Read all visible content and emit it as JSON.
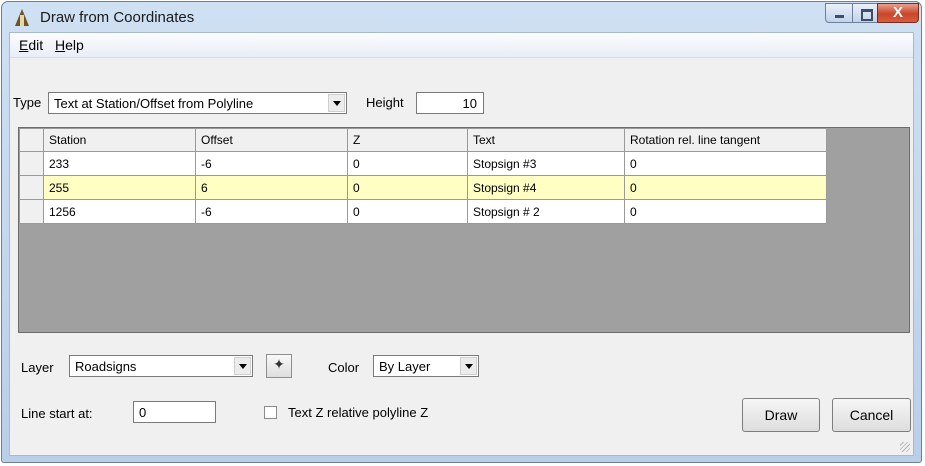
{
  "window": {
    "title": "Draw from Coordinates",
    "close_glyph": "X"
  },
  "menu": {
    "edit_label": "Edit",
    "help_label": "Help"
  },
  "type_row": {
    "type_label": "Type",
    "type_value": "Text at Station/Offset from Polyline",
    "height_label": "Height",
    "height_value": "10"
  },
  "grid": {
    "columns": [
      "Station",
      "Offset",
      "Z",
      "Text",
      "Rotation rel. line tangent"
    ],
    "rows": [
      [
        "233",
        "-6",
        "0",
        "Stopsign #3",
        "0"
      ],
      [
        "255",
        "6",
        "0",
        "Stopsign #4",
        "0"
      ],
      [
        "1256",
        "-6",
        "0",
        "Stopsign # 2",
        "0"
      ]
    ],
    "selected_row_index": 1,
    "selected_row_color": "#ffffc4"
  },
  "layer_row": {
    "layer_label": "Layer",
    "layer_value": "Roadsigns",
    "pick_glyph": "✦",
    "color_label": "Color",
    "color_value": "By Layer"
  },
  "bottom_row": {
    "line_start_label": "Line start at:",
    "line_start_value": "0",
    "checkbox_label": "Text Z relative polyline Z",
    "checkbox_checked": false,
    "draw_label": "Draw",
    "cancel_label": "Cancel"
  },
  "icons": {
    "app": "app-triangle-icon",
    "pick": "pick-point-icon",
    "resize": "resize-grip-icon"
  }
}
